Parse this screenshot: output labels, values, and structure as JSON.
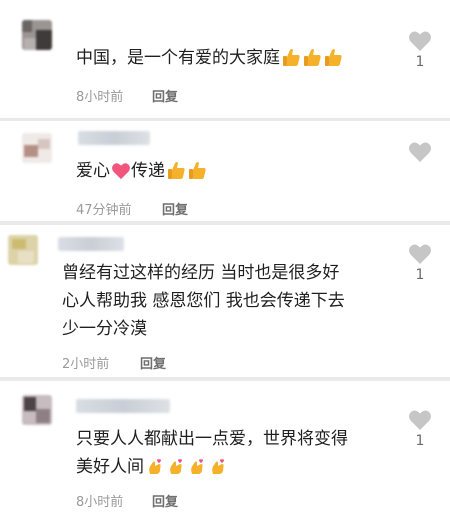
{
  "comments": [
    {
      "text_lines": [
        "中国，是一个有爱的大家庭"
      ],
      "emojis": [
        "thumbs-up",
        "thumbs-up",
        "thumbs-up"
      ],
      "time": "8小时前",
      "reply_label": "回复",
      "likes": "1"
    },
    {
      "text_before": "爱心",
      "text_after": "传递",
      "emojis": [
        "heart",
        "thumbs-up",
        "thumbs-up"
      ],
      "time": "47分钟前",
      "reply_label": "回复",
      "likes": ""
    },
    {
      "text_lines": [
        "曾经有过这样的经历 当时也是很多好",
        "心人帮助我 感恩您们 我也会传递下去",
        "少一分冷漠"
      ],
      "time": "2小时前",
      "reply_label": "回复",
      "likes": "1"
    },
    {
      "text_lines": [
        "只要人人都献出一点爱，世界将变得",
        "美好人间"
      ],
      "emojis": [
        "finger-heart",
        "finger-heart",
        "finger-heart",
        "finger-heart"
      ],
      "time": "8小时前",
      "reply_label": "回复",
      "likes": "1"
    }
  ],
  "colors": {
    "background": "#e9e9e9",
    "card": "#ffffff",
    "text": "#1f1f1f",
    "meta": "#9a9a9a",
    "heart_outline": "#c6c6c6",
    "emoji_heart": "#f1557e",
    "emoji_thumb": "#f5b12a"
  }
}
